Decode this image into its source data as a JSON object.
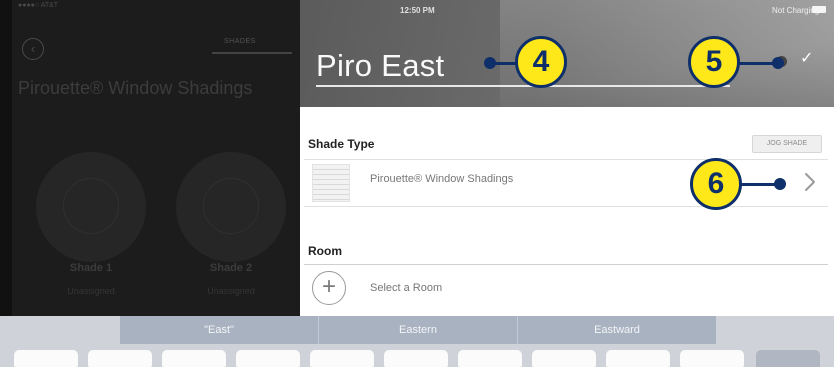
{
  "left_pane": {
    "status_carrier": "●●●●○ AT&T",
    "back_icon": "chevron-left-circle",
    "tab_label": "SHADES",
    "title": "Pirouette® Window Shadings",
    "shades": [
      {
        "name": "Shade 1",
        "status": "Unassigned"
      },
      {
        "name": "Shade 2",
        "status": "Unassigned"
      }
    ]
  },
  "header": {
    "time": "12:50 PM",
    "charging": "Not Charging",
    "name_value": "Piro East",
    "done_icon": "checkmark"
  },
  "shade_type": {
    "heading": "Shade Type",
    "jog_button": "JOG SHADE",
    "value": "Pirouette® Window Shadings",
    "chevron_icon": "chevron-right"
  },
  "room": {
    "heading": "Room",
    "add_icon": "plus-circle",
    "placeholder": "Select a Room"
  },
  "keyboard": {
    "predictions": [
      "\"East\"",
      "Eastern",
      "Eastward"
    ]
  },
  "callouts": [
    "4",
    "5",
    "6"
  ],
  "colors": {
    "callout_fill": "#ffe81a",
    "callout_outline": "#0e2f6a",
    "prediction_bar": "#a9b2c0"
  }
}
